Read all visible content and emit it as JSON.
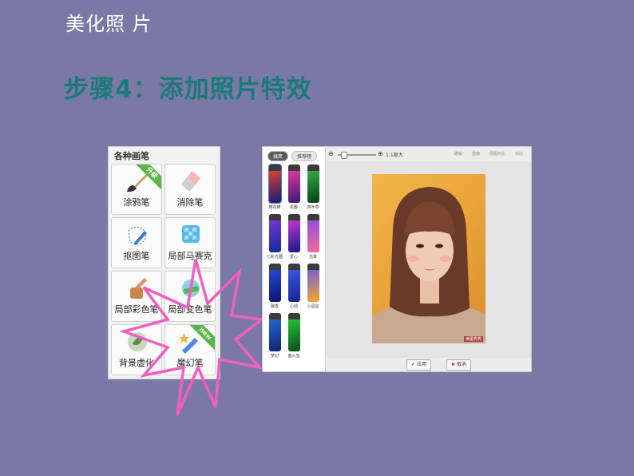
{
  "slide": {
    "title": "美化照 片",
    "step_title": "步骤4：添加照片特效"
  },
  "brush_panel": {
    "title": "各种画笔",
    "items": [
      {
        "label": "涂鸦笔",
        "icon": "paintbrush-icon",
        "badge": "升级"
      },
      {
        "label": "消除笔",
        "icon": "eraser-icon"
      },
      {
        "label": "抠图笔",
        "icon": "cutout-pen-icon"
      },
      {
        "label": "局部马赛克",
        "icon": "mosaic-icon"
      },
      {
        "label": "局部彩色笔",
        "icon": "color-pen-icon"
      },
      {
        "label": "局部变色笔",
        "icon": "color-change-icon"
      },
      {
        "label": "背景虚化",
        "icon": "blur-background-icon"
      },
      {
        "label": "魔幻笔",
        "icon": "magic-pen-icon",
        "badge": "new"
      }
    ]
  },
  "effects_window": {
    "tabs": [
      "搞笑",
      "推荐榜"
    ],
    "active_tab": 0,
    "toolbar": {
      "zoom_label": "1:1原大",
      "tools": [
        "撤销",
        "重做",
        "原图对比",
        "对比"
      ]
    },
    "effects": [
      {
        "label": "樱花棒",
        "selected": true,
        "colors": [
          "#e8452a",
          "#2a1e6e"
        ]
      },
      {
        "label": "花瓣",
        "colors": [
          "#e83aa0",
          "#4a1d7a"
        ]
      },
      {
        "label": "四叶草",
        "colors": [
          "#34b34a",
          "#0d4a1a"
        ]
      },
      {
        "label": "七彩光圈",
        "colors": [
          "#7a3ad8",
          "#1e2aa0"
        ]
      },
      {
        "label": "爱心",
        "colors": [
          "#c83ad8",
          "#2a1a8a"
        ]
      },
      {
        "label": "光晕",
        "colors": [
          "#8a4ae0",
          "#e86aa0"
        ]
      },
      {
        "label": "飘雪",
        "colors": [
          "#2a4ad8",
          "#0d1a7a"
        ]
      },
      {
        "label": "心动",
        "colors": [
          "#3a5ae8",
          "#1a2a9a"
        ]
      },
      {
        "label": "小星星",
        "colors": [
          "#6a5ae8",
          "#e8a03a"
        ]
      },
      {
        "label": "梦幻",
        "colors": [
          "#2a6ad8",
          "#102a7a"
        ]
      },
      {
        "label": "萤火虫",
        "colors": [
          "#2ac83a",
          "#0d5a1a"
        ]
      }
    ],
    "watermark": "美图秀秀",
    "buttons": {
      "apply": "应用",
      "cancel": "取消"
    }
  }
}
